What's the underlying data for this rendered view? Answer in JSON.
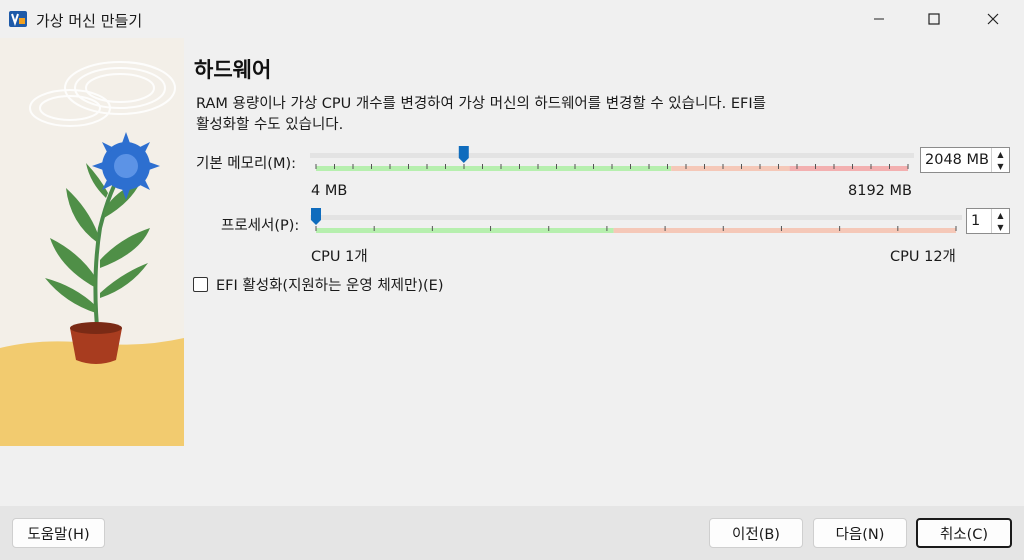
{
  "window": {
    "title": "가상 머신 만들기"
  },
  "page": {
    "heading": "하드웨어",
    "description_line1": "RAM 용량이나 가상 CPU 개수를 변경하여 가상 머신의 하드웨어를 변경할 수 있습니다. EFI를",
    "description_line2": "활성화할 수도 있습니다."
  },
  "memory": {
    "label": "기본 메모리(M):",
    "value": "2048 MB",
    "min_label": "4 MB",
    "max_label": "8192 MB",
    "min_mb": 4,
    "max_mb": 8192,
    "current_mb": 2048
  },
  "processor": {
    "label": "프로세서(P):",
    "value": "1",
    "min_label": "CPU 1개",
    "max_label": "CPU 12개",
    "min": 1,
    "max": 12,
    "current": 1
  },
  "efi": {
    "label": "EFI 활성화(지원하는 운영 체제만)(E)",
    "checked": false
  },
  "buttons": {
    "help": "도움말(H)",
    "back": "이전(B)",
    "next": "다음(N)",
    "cancel": "취소(C)"
  },
  "colors": {
    "green_zone": "#b6efae",
    "orange_zone": "#f5c8b8",
    "red_zone": "#f3b0b0",
    "thumb": "#0f6cbd",
    "sand": "#f2cb6f"
  }
}
